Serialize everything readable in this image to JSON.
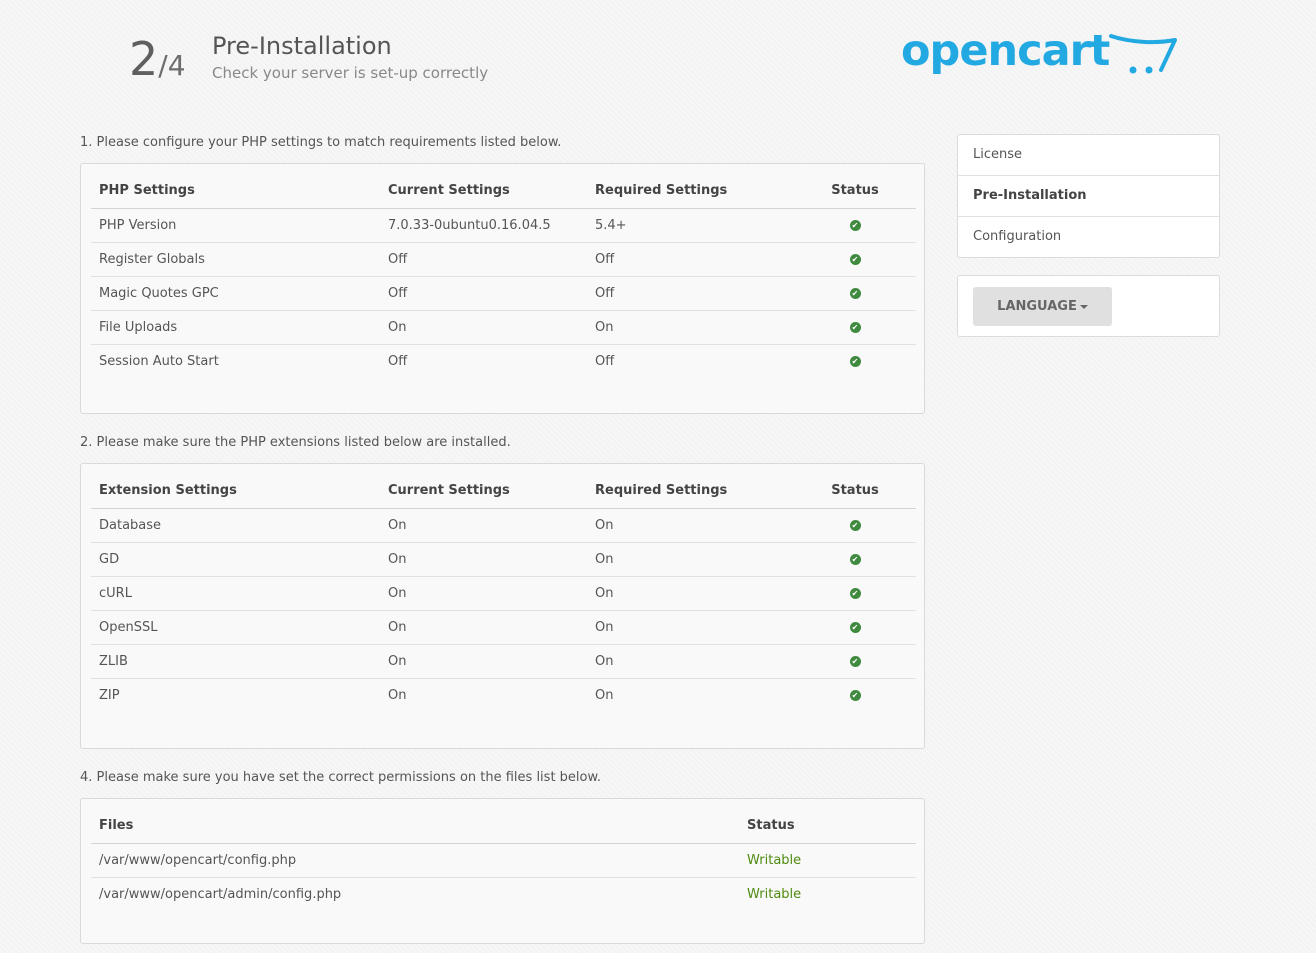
{
  "header": {
    "step_current": "2",
    "step_total": "/4",
    "title": "Pre-Installation",
    "subtitle": "Check your server is set-up correctly",
    "logo_text": "opencart",
    "brand_color": "#23a9e1"
  },
  "php": {
    "label": "1. Please configure your PHP settings to match requirements listed below.",
    "headers": [
      "PHP Settings",
      "Current Settings",
      "Required Settings",
      "Status"
    ],
    "rows": [
      {
        "name": "PHP Version",
        "current": "7.0.33-0ubuntu0.16.04.5",
        "required": "5.4+",
        "status_icon": "check-circle-icon"
      },
      {
        "name": "Register Globals",
        "current": "Off",
        "required": "Off",
        "status_icon": "check-circle-icon"
      },
      {
        "name": "Magic Quotes GPC",
        "current": "Off",
        "required": "Off",
        "status_icon": "check-circle-icon"
      },
      {
        "name": "File Uploads",
        "current": "On",
        "required": "On",
        "status_icon": "check-circle-icon"
      },
      {
        "name": "Session Auto Start",
        "current": "Off",
        "required": "Off",
        "status_icon": "check-circle-icon"
      }
    ]
  },
  "extensions": {
    "label": "2. Please make sure the PHP extensions listed below are installed.",
    "headers": [
      "Extension Settings",
      "Current Settings",
      "Required Settings",
      "Status"
    ],
    "rows": [
      {
        "name": "Database",
        "current": "On",
        "required": "On",
        "status_icon": "check-circle-icon"
      },
      {
        "name": "GD",
        "current": "On",
        "required": "On",
        "status_icon": "check-circle-icon"
      },
      {
        "name": "cURL",
        "current": "On",
        "required": "On",
        "status_icon": "check-circle-icon"
      },
      {
        "name": "OpenSSL",
        "current": "On",
        "required": "On",
        "status_icon": "check-circle-icon"
      },
      {
        "name": "ZLIB",
        "current": "On",
        "required": "On",
        "status_icon": "check-circle-icon"
      },
      {
        "name": "ZIP",
        "current": "On",
        "required": "On",
        "status_icon": "check-circle-icon"
      }
    ]
  },
  "files": {
    "label": "4. Please make sure you have set the correct permissions on the files list below.",
    "headers": [
      "Files",
      "Status"
    ],
    "rows": [
      {
        "path": "/var/www/opencart/config.php",
        "status": "Writable"
      },
      {
        "path": "/var/www/opencart/admin/config.php",
        "status": "Writable"
      }
    ]
  },
  "sidebar": {
    "items": [
      {
        "label": "License",
        "active": false
      },
      {
        "label": "Pre-Installation",
        "active": true
      },
      {
        "label": "Configuration",
        "active": false
      }
    ],
    "language_button": "LANGUAGE"
  }
}
